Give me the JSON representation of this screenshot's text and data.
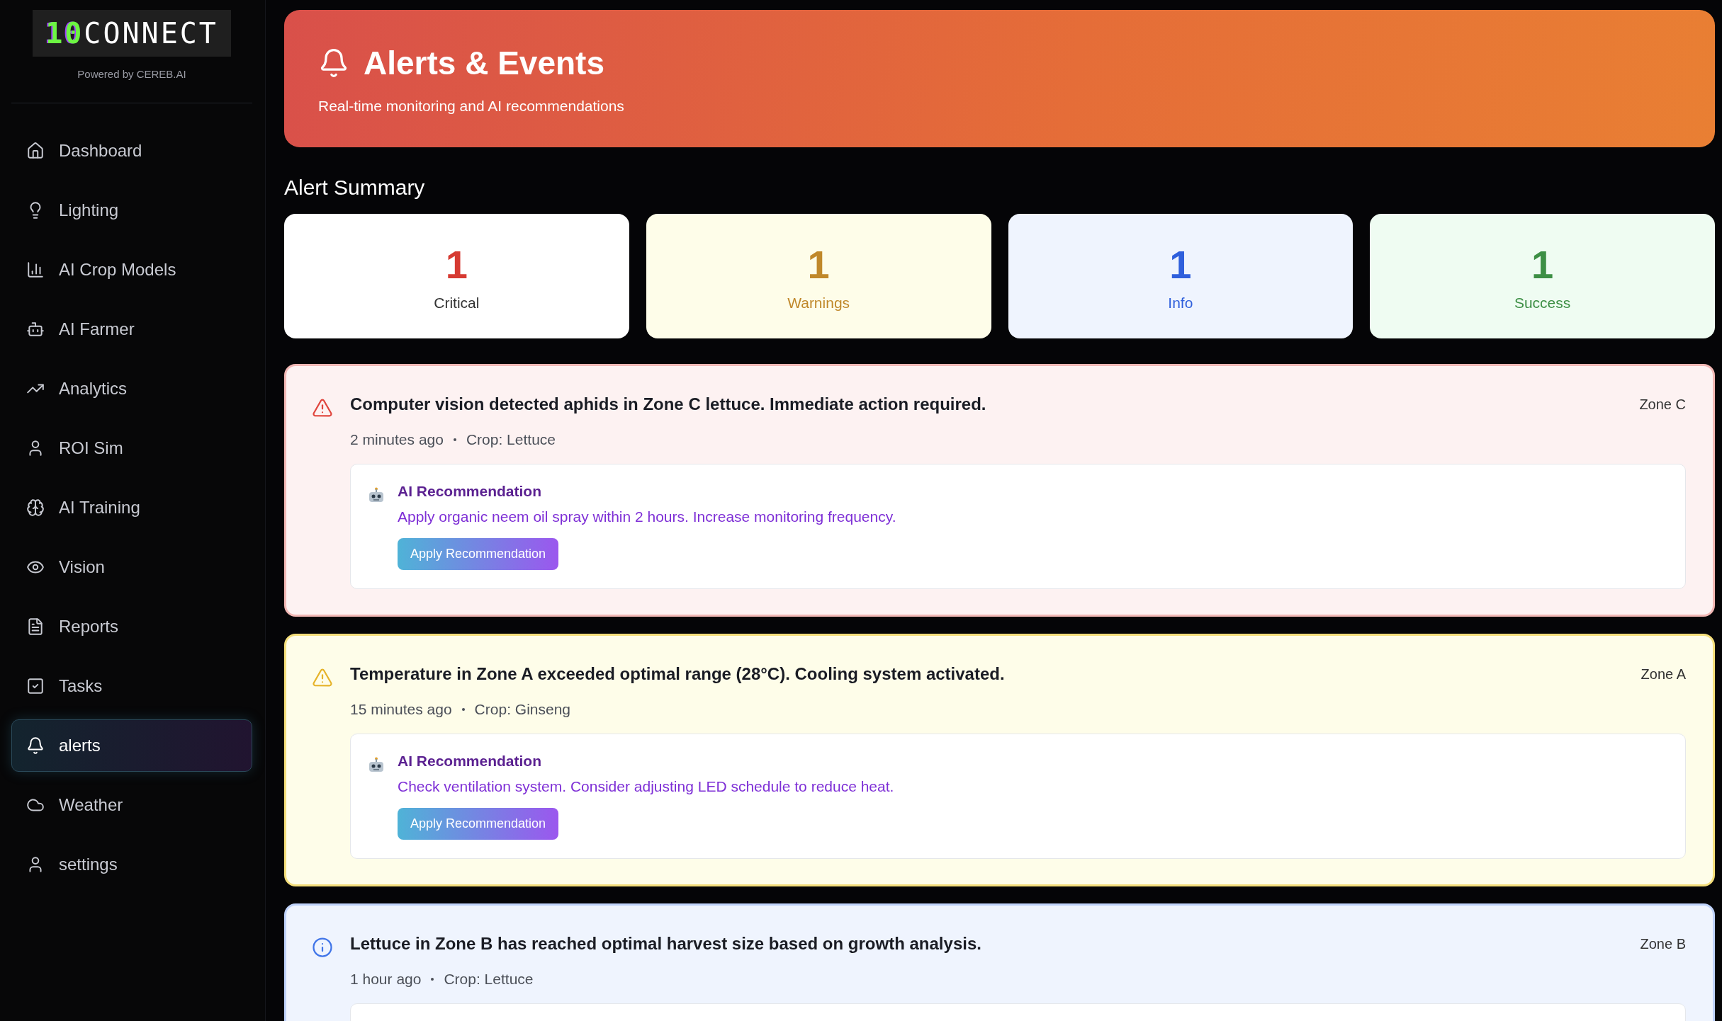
{
  "sidebar": {
    "logo": {
      "mark": "10",
      "text": "CONNECT"
    },
    "powered_by": "Powered by CEREB.AI",
    "items": [
      {
        "label": "Dashboard",
        "selected": false
      },
      {
        "label": "Lighting",
        "selected": false
      },
      {
        "label": "AI Crop Models",
        "selected": false
      },
      {
        "label": "AI Farmer",
        "selected": false
      },
      {
        "label": "Analytics",
        "selected": false
      },
      {
        "label": "ROI Sim",
        "selected": false
      },
      {
        "label": "AI Training",
        "selected": false
      },
      {
        "label": "Vision",
        "selected": false
      },
      {
        "label": "Reports",
        "selected": false
      },
      {
        "label": "Tasks",
        "selected": false
      },
      {
        "label": "alerts",
        "selected": true
      },
      {
        "label": "Weather",
        "selected": false
      },
      {
        "label": "settings",
        "selected": false
      }
    ]
  },
  "header": {
    "title": "Alerts & Events",
    "subtitle": "Real-time monitoring and AI recommendations"
  },
  "summary": {
    "title": "Alert Summary",
    "cards": [
      {
        "kind": "critical",
        "count": "1",
        "label": "Critical"
      },
      {
        "kind": "warning",
        "count": "1",
        "label": "Warnings"
      },
      {
        "kind": "info",
        "count": "1",
        "label": "Info"
      },
      {
        "kind": "success",
        "count": "1",
        "label": "Success"
      }
    ]
  },
  "alerts": [
    {
      "kind": "critical",
      "message": "Computer vision detected aphids in Zone C lettuce. Immediate action required.",
      "zone": "Zone C",
      "time": "2 minutes ago",
      "crop": "Crop: Lettuce",
      "recommendation": {
        "title": "AI Recommendation",
        "text": "Apply organic neem oil spray within 2 hours. Increase monitoring frequency.",
        "button": "Apply Recommendation"
      }
    },
    {
      "kind": "warning",
      "message": "Temperature in Zone A exceeded optimal range (28°C). Cooling system activated.",
      "zone": "Zone A",
      "time": "15 minutes ago",
      "crop": "Crop: Ginseng",
      "recommendation": {
        "title": "AI Recommendation",
        "text": "Check ventilation system. Consider adjusting LED schedule to reduce heat.",
        "button": "Apply Recommendation"
      }
    },
    {
      "kind": "info",
      "message": "Lettuce in Zone B has reached optimal harvest size based on growth analysis.",
      "zone": "Zone B",
      "time": "1 hour ago",
      "crop": "Crop: Lettuce"
    }
  ]
}
